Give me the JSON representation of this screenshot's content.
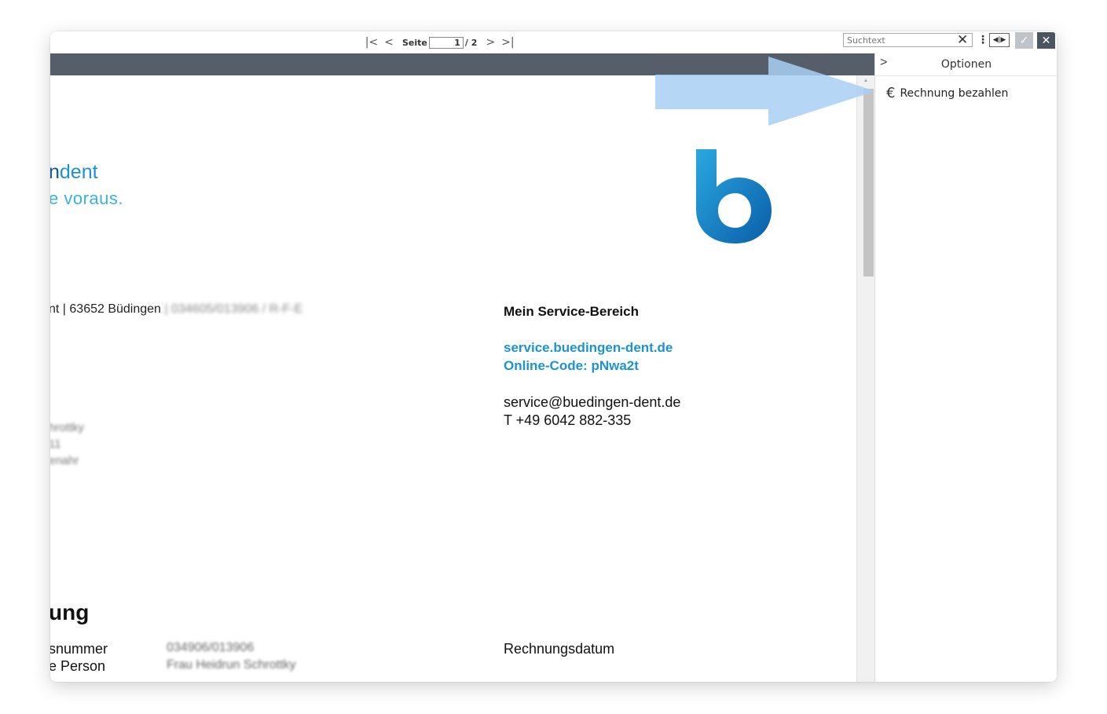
{
  "toolbar": {
    "first_page": "|<",
    "prev_page": "<",
    "page_label": "Seite",
    "page_value": "1",
    "page_total": "/ 2",
    "next_page": ">",
    "last_page": ">|",
    "search_placeholder": "Suchtext",
    "clear": "✕",
    "kebab": "⋮",
    "lr": "◀|▶",
    "confirm": "✓",
    "close": "✕"
  },
  "panel": {
    "collapse": ">",
    "title": "Optionen",
    "pay_icon": "€",
    "pay_label": "Rechnung bezahlen"
  },
  "document": {
    "brand_line1_bold": "n",
    "brand_line1_rest": "dent",
    "brand_line2": "e voraus.",
    "sender_line": "nt | 63652 Büdingen",
    "sender_blurred": "| 034605/013906 / R-F-E",
    "recipient_lines": [
      "hrottky",
      "11",
      "enahr"
    ],
    "service": {
      "title": "Mein Service-Bereich",
      "url": "service.buedingen-dent.de",
      "online_code": "Online-Code: pNwa2t",
      "email": "service@buedingen-dent.de",
      "phone": "T  +49 6042 882-335"
    },
    "heading": "ung",
    "field1_label": "snummer",
    "field1_value": "034906/013906",
    "field2_label": "e Person",
    "field2_value": "Frau Heidrun Schrottky",
    "date_label": "Rechnungsdatum"
  },
  "colors": {
    "band": "#555e69",
    "accent": "#1d93d1",
    "arrow": "#a9cff5"
  }
}
